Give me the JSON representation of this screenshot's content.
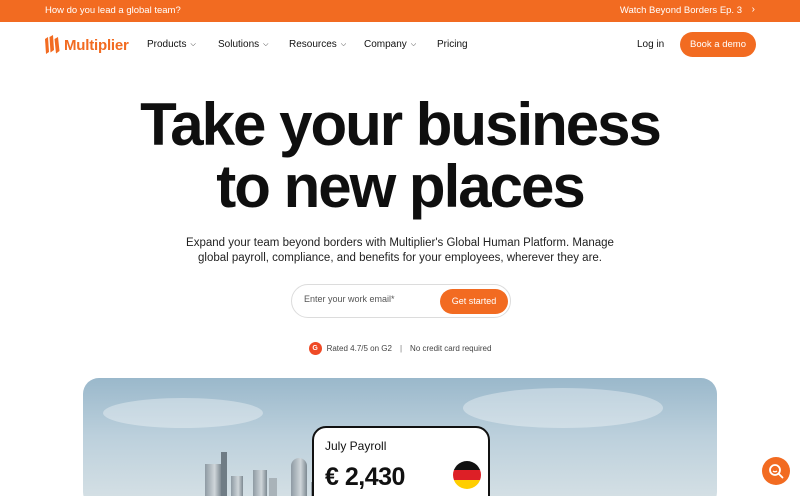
{
  "announcement": {
    "left_text": "How do you lead a global team?",
    "right_text": "Watch Beyond Borders Ep. 3",
    "chevron": "›"
  },
  "nav": {
    "brand": "Multiplier",
    "items": [
      {
        "label": "Products"
      },
      {
        "label": "Solutions"
      },
      {
        "label": "Resources"
      },
      {
        "label": "Company"
      },
      {
        "label": "Pricing"
      }
    ],
    "login": "Log in",
    "cta": "Book a demo"
  },
  "hero": {
    "title_line1": "Take your business",
    "title_line2": "to new places",
    "subtitle_line1": "Expand your team beyond borders with Multiplier's Global Human Platform. Manage",
    "subtitle_line2": "global payroll, compliance, and benefits for your employees, wherever they are."
  },
  "signup": {
    "placeholder": "Enter your work email*",
    "button": "Get started"
  },
  "trust": {
    "g2_badge": "G",
    "rating": "Rated 4.7/5 on G2",
    "separator": "|",
    "note": "No credit card required"
  },
  "payroll_card": {
    "label": "July Payroll",
    "amount": "€ 2,430",
    "flag_icon": "germany-flag-icon"
  },
  "colors": {
    "brand_orange": "#f26b21"
  }
}
